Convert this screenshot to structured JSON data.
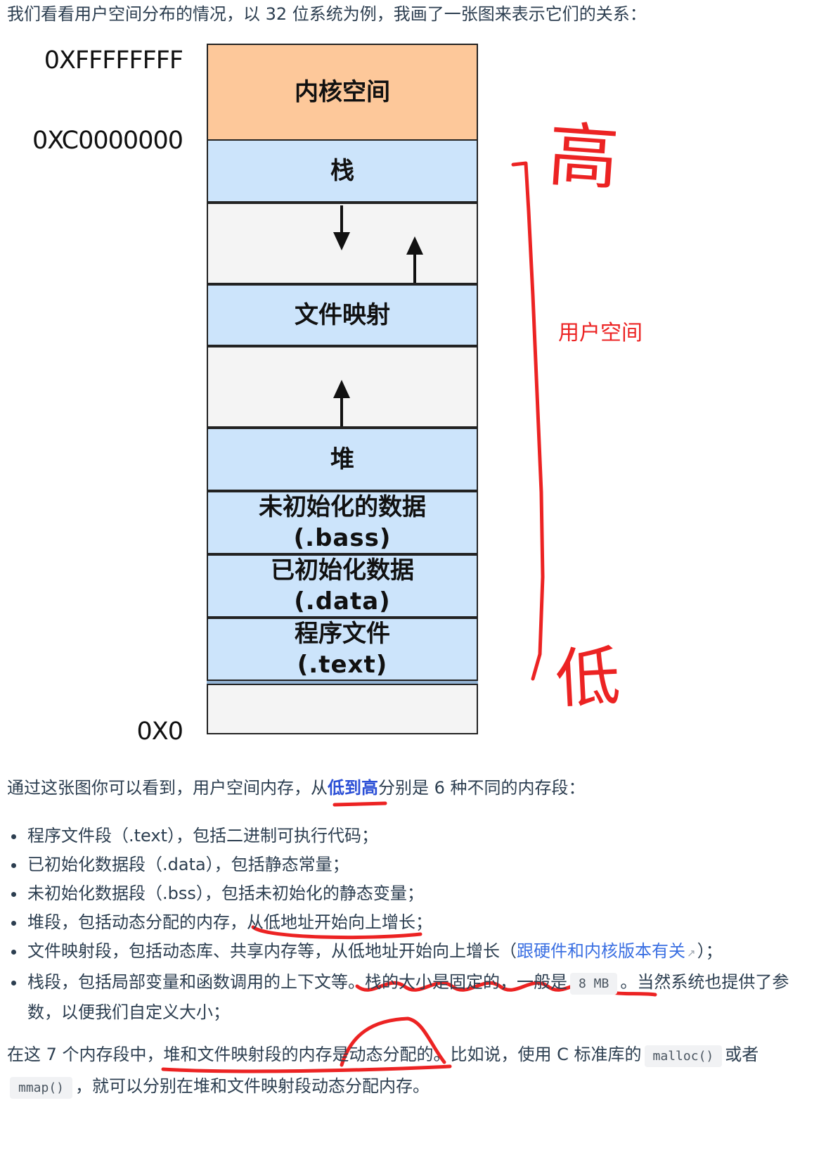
{
  "intro_text": "我们看看用户空间分布的情况，以 32 位系统为例，我画了一张图来表示它们的关系：",
  "diagram": {
    "addresses": {
      "top": "0XFFFFFFFF",
      "kernel_boundary": "0XC0000000",
      "bottom": "0X0"
    },
    "segments": {
      "kernel": "内核空间",
      "stack": "栈",
      "mmap": "文件映射",
      "heap": "堆",
      "bss": "未初始化的数据",
      "bss_sub": "(.bass)",
      "data": "已初始化数据",
      "data_sub": "(.data)",
      "text": "程序文件",
      "text_sub": "(.text)"
    },
    "annotations": {
      "high": "高",
      "low": "低",
      "user_space": "用户空间"
    },
    "colors": {
      "kernel": "#fdc89a",
      "user_segment": "#cce4fb",
      "gap": "#f4f4f4",
      "annotation": "#ec2323"
    }
  },
  "summary": {
    "prefix": "通过这张图你可以看到，用户空间内存，从",
    "highlight": "低到高",
    "suffix": "分别是 6 种不同的内存段："
  },
  "segment_list": {
    "item1": "程序文件段（.text），包括二进制可执行代码；",
    "item2": "已初始化数据段（.data），包括静态常量；",
    "item3": "未初始化数据段（.bss），包括未初始化的静态变量；",
    "item4": "堆段，包括动态分配的内存，从低地址开始向上增长；",
    "item5_prefix": "文件映射段，包括动态库、共享内存等，从低地址开始向上增长（",
    "item5_link": "跟硬件和内核版本有关",
    "item5_suffix": "）；",
    "item6_prefix": "栈段，包括局部变量和函数调用的上下文等。栈的大小是固定的，一般是",
    "item6_code": "8 MB",
    "item6_suffix": "。当然系统也提供了参数，以便我们自定义大小；"
  },
  "closing": {
    "part1": "在这 7 个内存段中，堆和文件映射段的内存是动态分配的。比如说，使用 C 标准库的",
    "code1": "malloc()",
    "part2": "或者",
    "code2": "mmap()",
    "part3": "，就可以分别在堆和文件映射段动态分配内存。"
  }
}
